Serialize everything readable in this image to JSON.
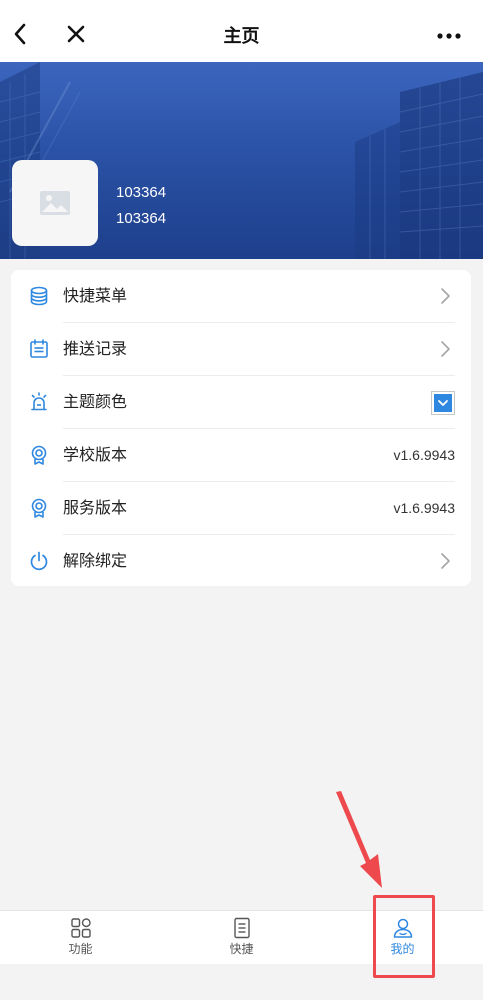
{
  "navbar": {
    "title": "主页",
    "back_icon": "chevron-left-icon",
    "close_icon": "close-icon",
    "more_icon": "more-horizontal-icon"
  },
  "profile": {
    "line1": "103364",
    "line2": "103364",
    "avatar_icon": "image-placeholder-icon"
  },
  "menu": {
    "items": [
      {
        "label": "快捷菜单",
        "icon": "stack-icon",
        "trailing": "chevron"
      },
      {
        "label": "推送记录",
        "icon": "calendar-list-icon",
        "trailing": "chevron"
      },
      {
        "label": "主题颜色",
        "icon": "alarm-light-icon",
        "trailing": "color-swatch"
      },
      {
        "label": "学校版本",
        "icon": "badge-icon",
        "value": "v1.6.9943"
      },
      {
        "label": "服务版本",
        "icon": "badge-icon",
        "value": "v1.6.9943"
      },
      {
        "label": "解除绑定",
        "icon": "power-icon",
        "trailing": "chevron"
      }
    ],
    "theme_color": "#2f88e0"
  },
  "tabbar": {
    "tabs": [
      {
        "label": "功能",
        "icon": "grid-icon",
        "active": false
      },
      {
        "label": "快捷",
        "icon": "document-icon",
        "active": false
      },
      {
        "label": "我的",
        "icon": "user-icon",
        "active": true
      }
    ]
  },
  "colors": {
    "accent": "#2f88e0",
    "banner": "#2a52a6",
    "annotation": "#ee4a4e"
  }
}
